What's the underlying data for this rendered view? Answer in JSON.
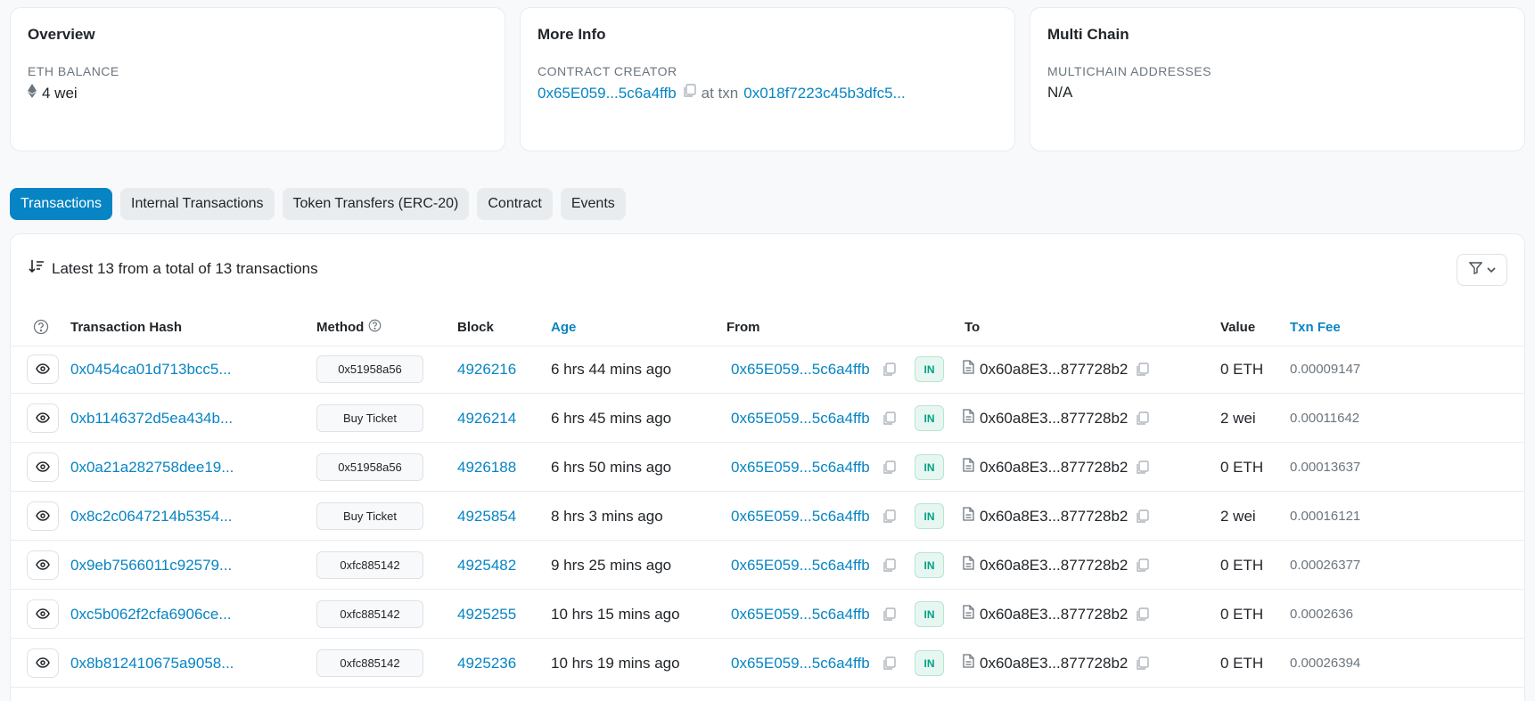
{
  "overview": {
    "title": "Overview",
    "balance_label": "ETH BALANCE",
    "balance_value": "4 wei"
  },
  "more_info": {
    "title": "More Info",
    "creator_label": "CONTRACT CREATOR",
    "creator_address": "0x65E059...5c6a4ffb",
    "at_txn_label": "at txn",
    "creator_txn": "0x018f7223c45b3dfc5..."
  },
  "multi_chain": {
    "title": "Multi Chain",
    "label": "MULTICHAIN ADDRESSES",
    "value": "N/A"
  },
  "tabs": [
    {
      "label": "Transactions"
    },
    {
      "label": "Internal Transactions"
    },
    {
      "label": "Token Transfers (ERC-20)"
    },
    {
      "label": "Contract"
    },
    {
      "label": "Events"
    }
  ],
  "summary": "Latest 13 from a total of 13 transactions",
  "columns": {
    "hash": "Transaction Hash",
    "method": "Method",
    "block": "Block",
    "age": "Age",
    "from": "From",
    "to": "To",
    "value": "Value",
    "fee": "Txn Fee"
  },
  "rows": [
    {
      "hash": "0x0454ca01d713bcc5...",
      "method": "0x51958a56",
      "block": "4926216",
      "age": "6 hrs 44 mins ago",
      "from": "0x65E059...5c6a4ffb",
      "direction": "IN",
      "to": "0x60a8E3...877728b2",
      "value": "0 ETH",
      "fee": "0.00009147"
    },
    {
      "hash": "0xb1146372d5ea434b...",
      "method": "Buy Ticket",
      "block": "4926214",
      "age": "6 hrs 45 mins ago",
      "from": "0x65E059...5c6a4ffb",
      "direction": "IN",
      "to": "0x60a8E3...877728b2",
      "value": "2 wei",
      "fee": "0.00011642"
    },
    {
      "hash": "0x0a21a282758dee19...",
      "method": "0x51958a56",
      "block": "4926188",
      "age": "6 hrs 50 mins ago",
      "from": "0x65E059...5c6a4ffb",
      "direction": "IN",
      "to": "0x60a8E3...877728b2",
      "value": "0 ETH",
      "fee": "0.00013637"
    },
    {
      "hash": "0x8c2c0647214b5354...",
      "method": "Buy Ticket",
      "block": "4925854",
      "age": "8 hrs 3 mins ago",
      "from": "0x65E059...5c6a4ffb",
      "direction": "IN",
      "to": "0x60a8E3...877728b2",
      "value": "2 wei",
      "fee": "0.00016121"
    },
    {
      "hash": "0x9eb7566011c92579...",
      "method": "0xfc885142",
      "block": "4925482",
      "age": "9 hrs 25 mins ago",
      "from": "0x65E059...5c6a4ffb",
      "direction": "IN",
      "to": "0x60a8E3...877728b2",
      "value": "0 ETH",
      "fee": "0.00026377"
    },
    {
      "hash": "0xc5b062f2cfa6906ce...",
      "method": "0xfc885142",
      "block": "4925255",
      "age": "10 hrs 15 mins ago",
      "from": "0x65E059...5c6a4ffb",
      "direction": "IN",
      "to": "0x60a8E3...877728b2",
      "value": "0 ETH",
      "fee": "0.0002636"
    },
    {
      "hash": "0x8b812410675a9058...",
      "method": "0xfc885142",
      "block": "4925236",
      "age": "10 hrs 19 mins ago",
      "from": "0x65E059...5c6a4ffb",
      "direction": "IN",
      "to": "0x60a8E3...877728b2",
      "value": "0 ETH",
      "fee": "0.00026394"
    }
  ],
  "colors": {
    "link": "#0784c3",
    "active_tab": "#0784c3",
    "in_badge": "#00a186"
  }
}
